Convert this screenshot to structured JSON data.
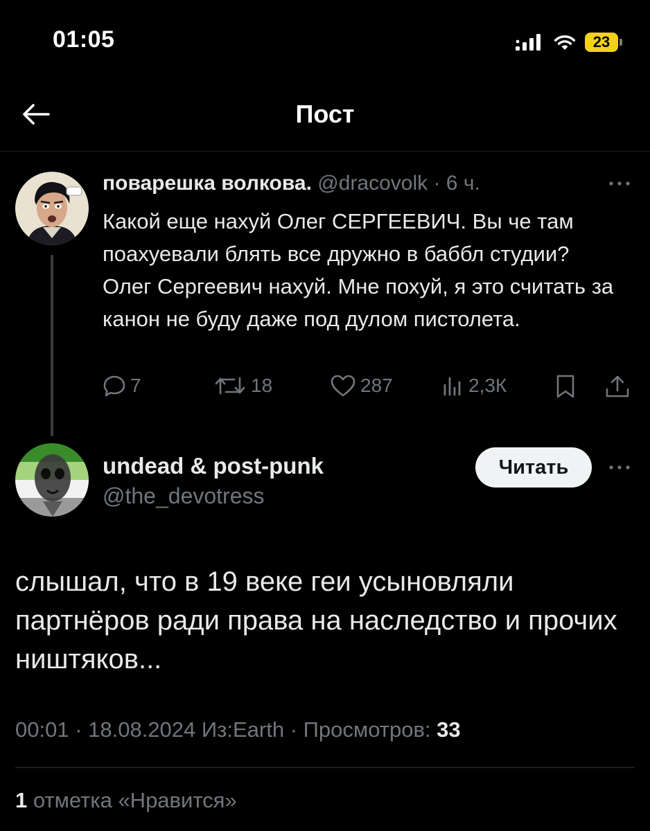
{
  "status_bar": {
    "time": "01:05",
    "battery": "23",
    "icons": [
      "signal-icon",
      "wifi-icon",
      "battery-icon"
    ]
  },
  "header": {
    "title": "Пост",
    "back_icon": "arrow-left-icon"
  },
  "quoted_tweet": {
    "display_name": "поварешка волкова.",
    "handle": "@dracovolk",
    "time": "· 6 ч.",
    "text": "Какой еще нахуй Олег СЕРГЕЕВИЧ. Вы че там поахуевали блять все дружно в баббл студии? Олег Сергеевич нахуй. Мне похуй, я это считать за канон не буду даже под дулом пистолета.",
    "actions": {
      "replies": "7",
      "retweets": "18",
      "likes": "287",
      "views": "2,3К"
    }
  },
  "main_tweet": {
    "display_name": "undead & post-punk",
    "handle": "@the_devotress",
    "follow_label": "Читать",
    "text": "слышал, что в 19 веке геи усыновляли партнёров ради права на наследство и прочих ништяков...",
    "meta_prefix": "00:01 · 18.08.2024 Из:Earth · Просмотров: ",
    "views": "33",
    "likes_count": "1",
    "likes_label": " отметка «Нравится»"
  },
  "colors": {
    "background": "#000000",
    "text": "#e7e9ea",
    "muted": "#71767b",
    "battery": "#f2d11b"
  }
}
